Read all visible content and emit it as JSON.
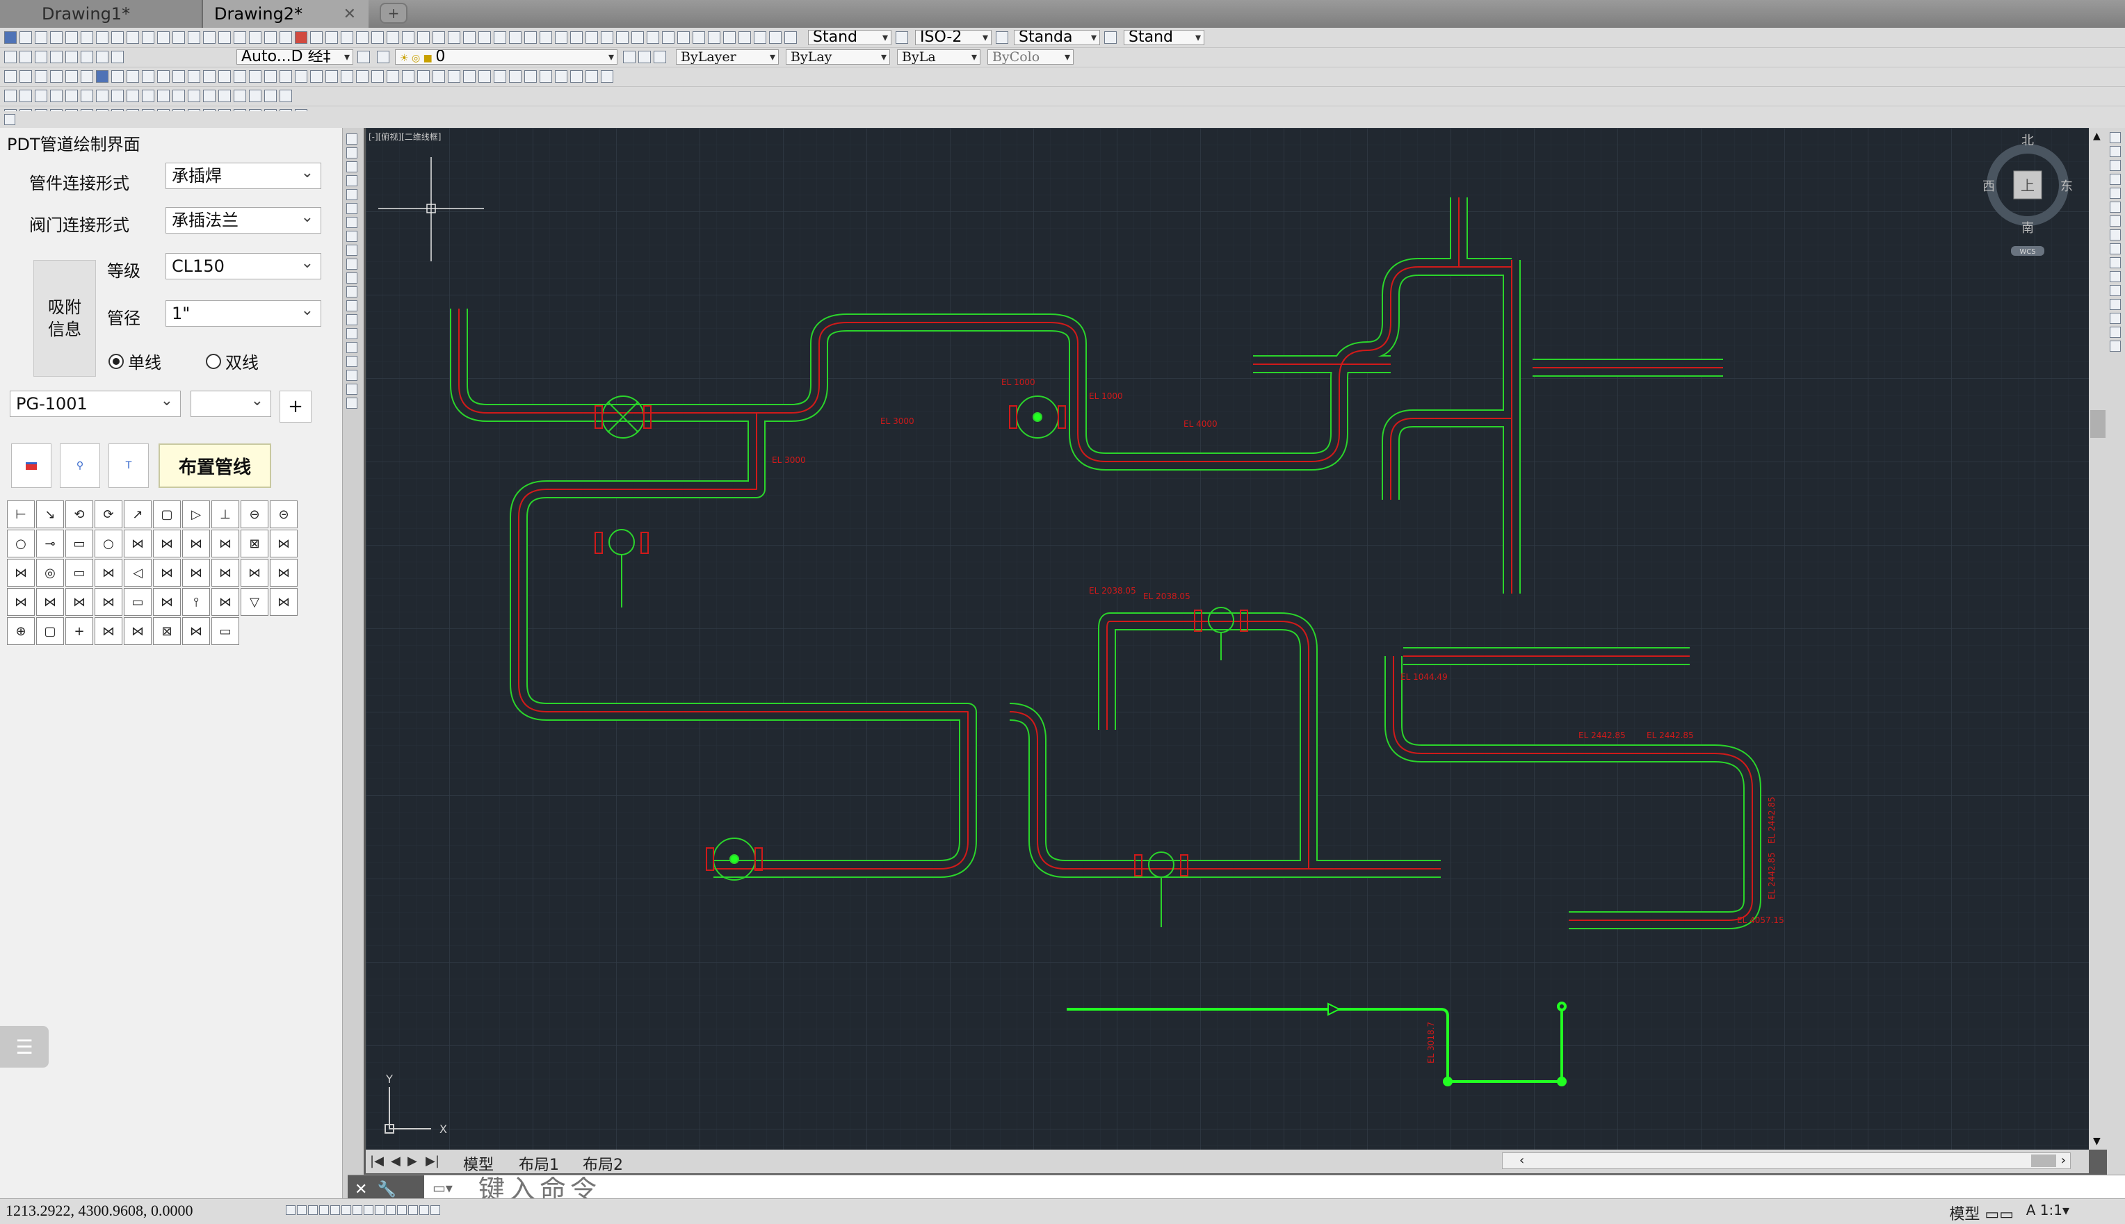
{
  "tabs": [
    {
      "label": "Drawing1*",
      "active": false
    },
    {
      "label": "Drawing2*",
      "active": true
    }
  ],
  "toolbar": {
    "text_style": "Stand",
    "dim_style": "ISO-2",
    "table_style": "Standa",
    "multileader_style": "Stand",
    "workspace": "Auto...D 经‡",
    "layer": "0",
    "color": "ByLayer",
    "linetype": "ByLay",
    "lineweight": "ByLa",
    "plotstyle": "ByColo"
  },
  "panel": {
    "title": "PDT管道绘制界面",
    "fitting_label": "管件连接形式",
    "fitting_value": "承插焊",
    "valve_label": "阀门连接形式",
    "valve_value": "承插法兰",
    "attach_label": "吸附信息",
    "grade_label": "等级",
    "grade_value": "CL150",
    "size_label": "管径",
    "size_value": "1\"",
    "single_line": "单线",
    "double_line": "双线",
    "line_number": "PG-1001",
    "line_number2": "",
    "add_button": "+",
    "place_button": "布置管线",
    "symbols": [
      "⊢",
      "↘",
      "⟲",
      "⟳",
      "↗",
      "▢",
      "▷",
      "⊥",
      "⊖",
      "⊝",
      "○",
      "⊸",
      "▭",
      "○",
      "⋈",
      "⋈",
      "⋈",
      "⋈",
      "⊠",
      "⋈",
      "⋈",
      "◎",
      "▭",
      "⋈",
      "◁",
      "⋈",
      "⋈",
      "⋈",
      "⋈",
      "⋈",
      "⋈",
      "⋈",
      "⋈",
      "⋈",
      "▭",
      "⋈",
      "⫯",
      "⋈",
      "▽",
      "⋈",
      "⊕",
      "▢",
      "+",
      "⋈",
      "⋈",
      "⊠",
      "⋈",
      "▭"
    ]
  },
  "canvas": {
    "viewport_label": "[-][俯视][二维线框]",
    "compass": {
      "north": "北",
      "south": "南",
      "east": "东",
      "west": "西",
      "top": "上",
      "wcs": "WCS"
    },
    "ucs": {
      "x": "X",
      "y": "Y"
    },
    "elevations": [
      "EL 3000",
      "EL 3000",
      "EL 1000",
      "EL 1000",
      "EL 4000",
      "EL 2038.05",
      "EL 2038.05",
      "EL 1044.49",
      "EL 2442.85",
      "EL 2442.85",
      "EL 2442.85",
      "EL 2442.85",
      "EL 4057.15",
      "EL 3018.7"
    ]
  },
  "layouts": [
    "模型",
    "布局1",
    "布局2"
  ],
  "command": {
    "placeholder": "键入命令"
  },
  "status": {
    "coordinates": "1213.2922,  4300.9608,  0.0000",
    "model": "模型",
    "scale": "1:1"
  },
  "colors": {
    "canvas_bg": "#212830",
    "pipe_green": "#2bd42b",
    "pipe_red": "#d01a1a",
    "polyline_green": "#22ff22"
  }
}
